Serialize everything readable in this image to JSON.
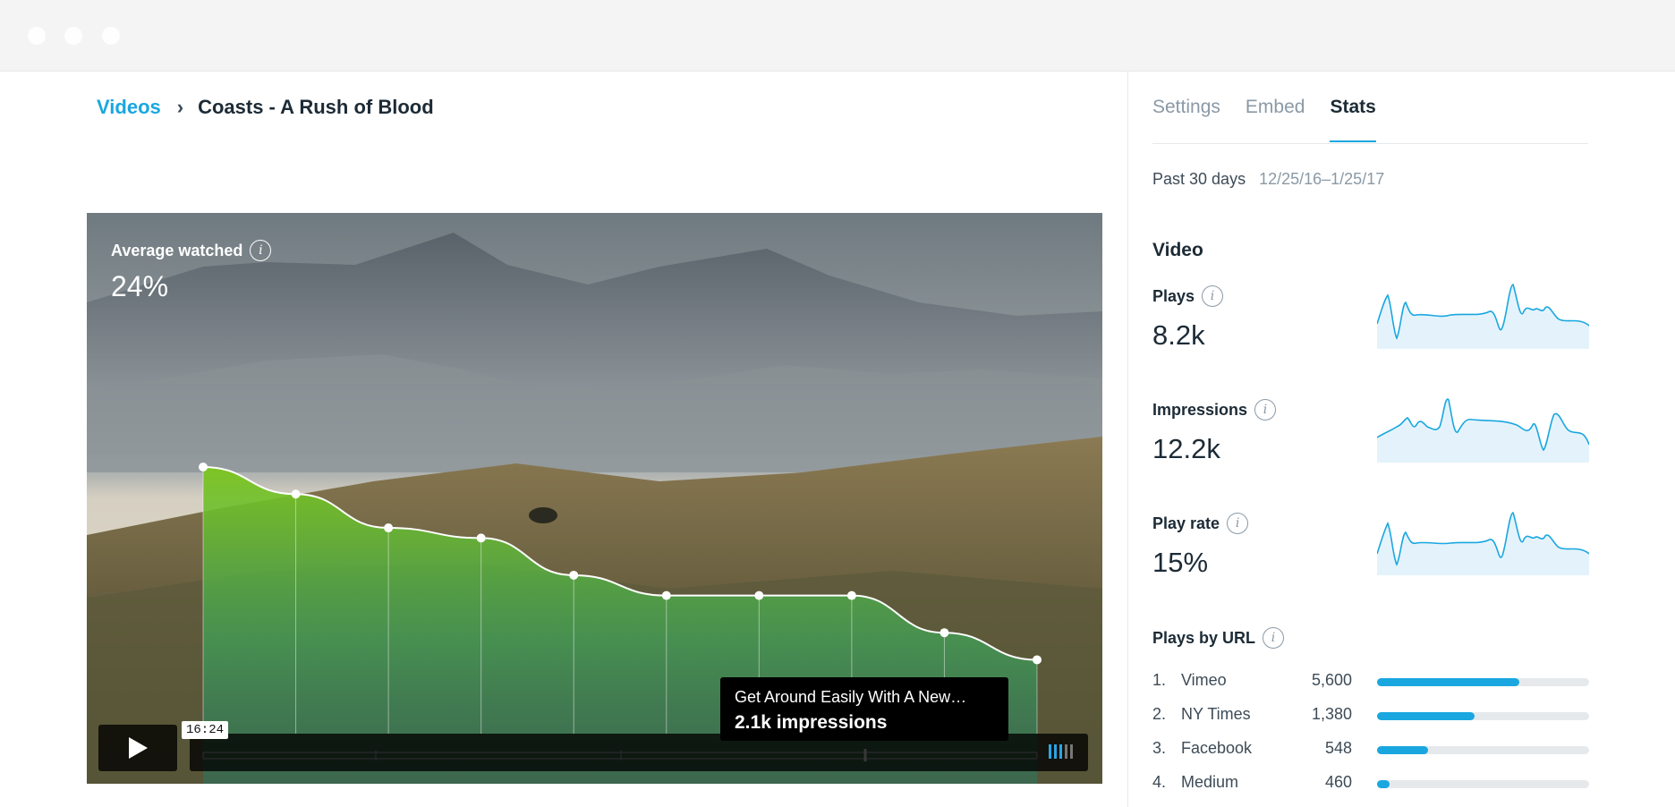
{
  "breadcrumb": {
    "parent": "Videos",
    "separator": "›",
    "current": "Coasts - A Rush of Blood"
  },
  "player": {
    "avg_label": "Average watched",
    "avg_value": "24%",
    "time": "16:24",
    "tooltip_title": "Get Around Easily With A New…",
    "tooltip_value": "2.1k impressions",
    "retention_points": [
      100,
      92,
      82,
      79,
      68,
      62,
      62,
      62,
      51,
      43
    ]
  },
  "tabs": [
    "Settings",
    "Embed",
    "Stats"
  ],
  "active_tab": "Stats",
  "range": {
    "label": "Past 30 days",
    "dates": "12/25/16–1/25/17"
  },
  "video": {
    "title": "Video",
    "metrics": [
      {
        "label": "Plays",
        "value": "8.2k"
      },
      {
        "label": "Impressions",
        "value": "12.2k"
      },
      {
        "label": "Play rate",
        "value": "15%"
      }
    ]
  },
  "plays_by_url": {
    "title": "Plays by URL",
    "rows": [
      {
        "rank": "1.",
        "name": "Vimeo",
        "count": "5,600",
        "share": 0.67
      },
      {
        "rank": "2.",
        "name": "NY Times",
        "count": "1,380",
        "share": 0.46
      },
      {
        "rank": "3.",
        "name": "Facebook",
        "count": "548",
        "share": 0.24
      },
      {
        "rank": "4.",
        "name": "Medium",
        "count": "460",
        "share": 0.06
      }
    ]
  },
  "colors": {
    "accent": "#1aa7e0",
    "text": "#1c2b36",
    "muted": "#8a99a6",
    "retention": "#6cc22e"
  }
}
